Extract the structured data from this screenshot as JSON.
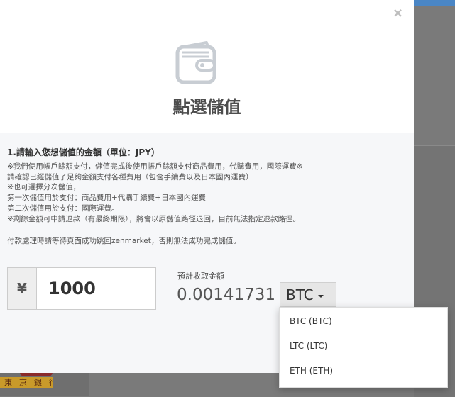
{
  "background": {
    "bank_text": "東京銀行"
  },
  "modal": {
    "close_glyph": "×",
    "title": "點選儲值",
    "icon": "wallet-icon",
    "step_title": "1.請輸入您想儲值的金額（單位：JPY）",
    "notes": [
      "※我們使用帳戶餘額支付，儲值完成後使用帳戶餘額支付商品費用，代購費用，國際運費※",
      "請確認已經儲值了足夠金額支付各種費用（包含手續費以及日本國內運費）",
      "※也可選擇分次儲值，",
      "第一次儲值用於支付：商品費用+代購手續費+日本國內運費",
      "第二次儲值用於支付：國際運費。",
      "※剩餘金額可申請退款（有最終期限），將會以原儲值路徑退回，目前無法指定退款路徑。"
    ],
    "payment_note": "付款處理時請等待頁面成功跳回zenmarket，否則無法成功完成儲值。",
    "amount": {
      "currency_symbol": "¥",
      "value": "1000"
    },
    "estimate": {
      "label": "預計收取金額",
      "value": "0.00141731"
    },
    "crypto_select": {
      "selected": "BTC",
      "options": [
        "BTC (BTC)",
        "LTC (LTC)",
        "ETH (ETH)"
      ]
    }
  },
  "colors": {
    "topbar": "#4a86c5",
    "body_bg": "#f6f7f9",
    "overlay": "#7a7a7a"
  }
}
